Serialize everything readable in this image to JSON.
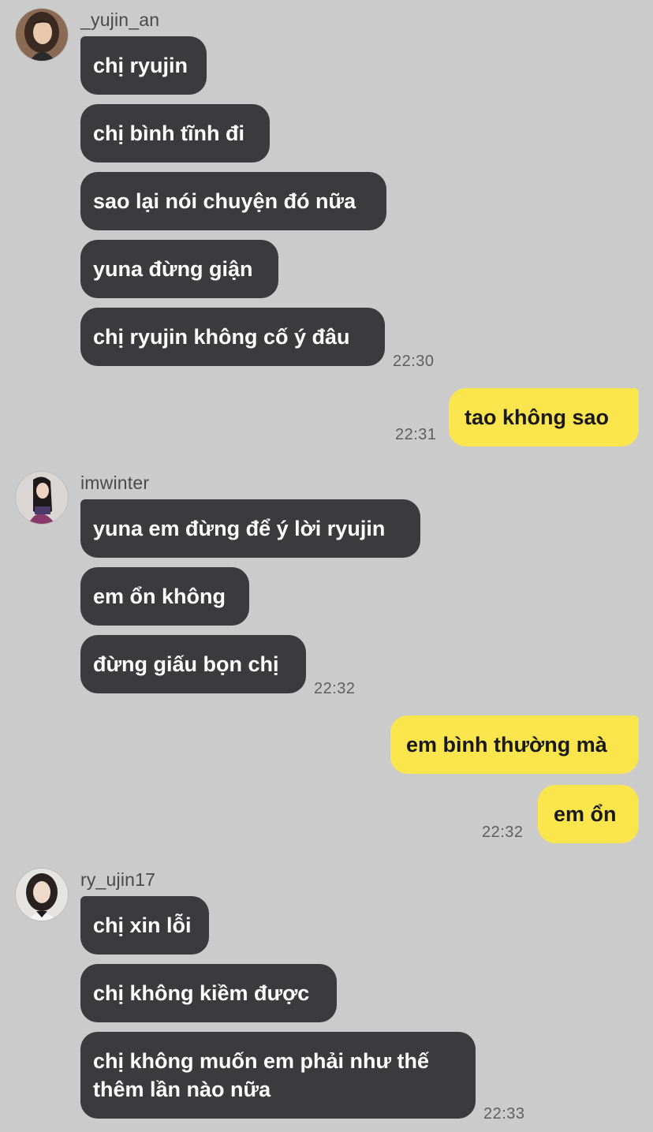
{
  "chat": {
    "groups": [
      {
        "sender": "_yujin_an",
        "avatar_icon": "profile-photo-yujin-an",
        "messages": [
          "chị ryujin",
          "chị bình tĩnh đi",
          "sao lại nói chuyện đó nữa",
          "yuna đừng giận",
          "chị ryujin không cố ý đâu"
        ],
        "time": "22:30"
      },
      {
        "sender": "me",
        "messages": [
          "tao không sao"
        ],
        "time": "22:31"
      },
      {
        "sender": "imwinter",
        "avatar_icon": "profile-photo-imwinter",
        "messages": [
          "yuna em đừng để ý lời ryujin",
          "em ổn không",
          "đừng giấu bọn chị"
        ],
        "time": "22:32"
      },
      {
        "sender": "me",
        "messages": [
          "em bình thường mà",
          "em ổn"
        ],
        "time": "22:32"
      },
      {
        "sender": "ry_ujin17",
        "avatar_icon": "profile-photo-ry-ujin17",
        "messages": [
          "chị xin lỗi",
          "chị không kiềm được",
          "chị không muốn em phải như thế thêm lần nào nữa"
        ],
        "time": "22:33"
      }
    ]
  },
  "colors": {
    "background": "#cbcbcb",
    "incoming_bubble": "#3b3b3d",
    "outgoing_bubble": "#fae54d",
    "incoming_text": "#ffffff",
    "outgoing_text": "#191919",
    "timestamp": "#5e5e5e"
  }
}
